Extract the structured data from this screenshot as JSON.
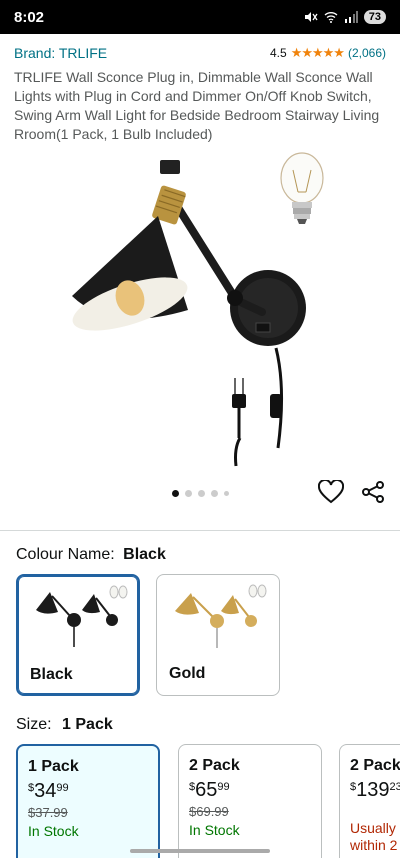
{
  "status_bar": {
    "time": "8:02",
    "battery": "73"
  },
  "brand": {
    "label": "Brand: TRLIFE"
  },
  "rating": {
    "value": "4.5",
    "stars": "★★★★★",
    "count": "(2,066)",
    "level_out_of_5": 4.5
  },
  "product": {
    "title": "TRLIFE Wall Sconce Plug in, Dimmable Wall Sconce Wall Lights with Plug in Cord and Dimmer On/Off Knob Switch, Swing Arm Wall Light for Bedside Bedroom Stairway Living Rroom(1 Pack, 1 Bulb Included)"
  },
  "gallery": {
    "image_count": 5,
    "active_index": 0
  },
  "colour": {
    "label": "Colour Name:",
    "selected": "Black",
    "options": [
      {
        "name": "Black"
      },
      {
        "name": "Gold"
      }
    ]
  },
  "size": {
    "label": "Size:",
    "selected": "1 Pack",
    "options": [
      {
        "name": "1 Pack",
        "price_currency": "$",
        "price_whole": "34",
        "price_fraction": "99",
        "old_price": "$37.99",
        "stock": "In Stock"
      },
      {
        "name": "2 Pack",
        "price_currency": "$",
        "price_whole": "65",
        "price_fraction": "99",
        "old_price": "$69.99",
        "stock": "In Stock"
      },
      {
        "name": "2 Pack",
        "price_currency": "$",
        "price_whole": "139",
        "price_fraction": "23",
        "usually_line1": "Usually",
        "usually_line2": "within 2"
      }
    ]
  },
  "colors": {
    "link": "#007185",
    "star": "#f0830c",
    "selected_border": "#2162a1",
    "in_stock": "#007600"
  }
}
